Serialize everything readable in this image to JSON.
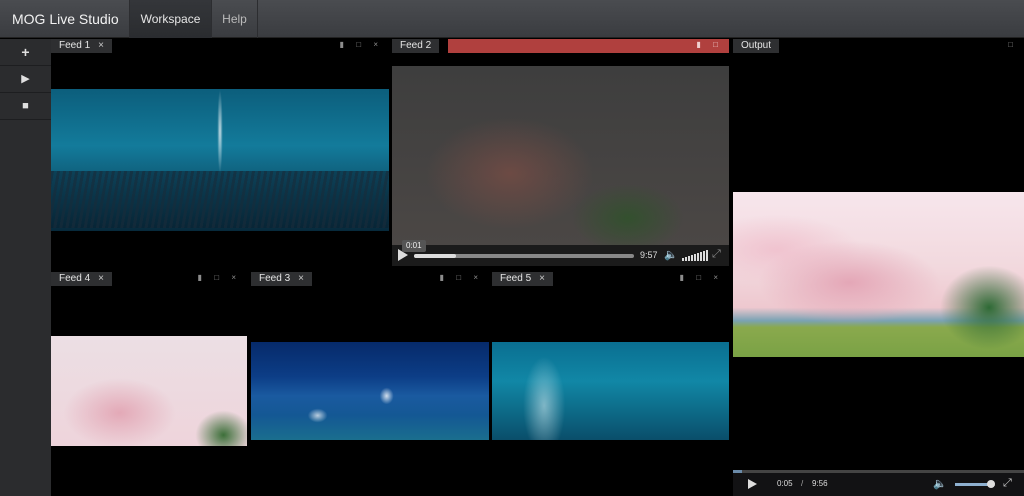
{
  "app": {
    "title": "MOG Live Studio"
  },
  "menu": {
    "workspace": "Workspace",
    "help": "Help"
  },
  "toolbar": {
    "add_label": "+",
    "play_label": "▶",
    "stop_label": "■"
  },
  "feeds": {
    "feed1": {
      "label": "Feed 1",
      "close": "×"
    },
    "feed2": {
      "label": "Feed 2",
      "close": ""
    },
    "feed3": {
      "label": "Feed 3",
      "close": "×"
    },
    "feed4": {
      "label": "Feed 4",
      "close": "×"
    },
    "feed5": {
      "label": "Feed 5",
      "close": "×"
    }
  },
  "output": {
    "label": "Output"
  },
  "feed2_player": {
    "tooltip": "0:01",
    "duration": "9:57",
    "progress_fraction": 0.19,
    "volume_bars": 9
  },
  "output_player": {
    "current_time": "0:05",
    "separator": "/",
    "duration": "9:56",
    "progress_fraction": 0.03,
    "volume_fraction": 0.9
  },
  "icons": {
    "panel_icons": "▮ □ ×",
    "volume": "🔈",
    "fullscreen": "⤢"
  },
  "colors": {
    "active_feed_bar": "#b0403e"
  }
}
